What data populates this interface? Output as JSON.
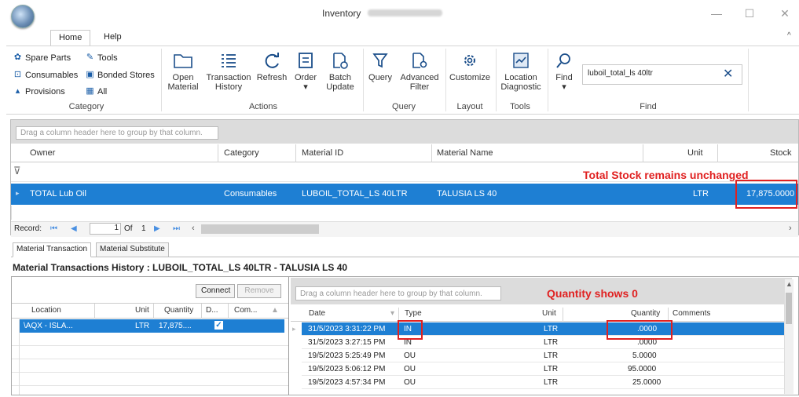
{
  "window": {
    "title": "Inventory",
    "min_label": "—",
    "max_label": "☐",
    "close_label": "✕"
  },
  "ribbon_tabs": {
    "home": "Home",
    "help": "Help",
    "collapse": "^"
  },
  "category": {
    "spare_parts": "Spare Parts",
    "tools": "Tools",
    "consumables": "Consumables",
    "bonded_stores": "Bonded Stores",
    "provisions": "Provisions",
    "all": "All",
    "label": "Category"
  },
  "actions": {
    "open_material": [
      "Open",
      "Material"
    ],
    "transaction_history": [
      "Transaction",
      "History"
    ],
    "refresh": "Refresh",
    "order": "Order",
    "batch_update": [
      "Batch",
      "Update"
    ],
    "label": "Actions"
  },
  "query": {
    "query": "Query",
    "advanced_filter": [
      "Advanced",
      "Filter"
    ],
    "label": "Query"
  },
  "layout": {
    "customize": "Customize",
    "label": "Layout"
  },
  "tools": {
    "location_diagnostic": [
      "Location",
      "Diagnostic"
    ],
    "label": "Tools"
  },
  "find": {
    "find": "Find",
    "value": "luboil_total_ls 40ltr",
    "label": "Find"
  },
  "upper_grid": {
    "group_hint": "Drag a column header here to group by that column.",
    "columns": {
      "owner": "Owner",
      "category": "Category",
      "material_id": "Material ID",
      "material_name": "Material Name",
      "unit": "Unit",
      "stock": "Stock"
    },
    "row": {
      "owner": "TOTAL Lub Oil",
      "category": "Consumables",
      "material_id": "LUBOIL_TOTAL_LS 40LTR",
      "material_name": "TALUSIA LS 40",
      "unit": "LTR",
      "stock": "17,875.0000"
    },
    "record_label": "Record:",
    "record_pos": "1",
    "record_of": "Of",
    "record_total": "1"
  },
  "annotations": {
    "stock": "Total Stock remains unchanged",
    "quantity": "Quantity shows 0"
  },
  "lower_tabs": {
    "transaction": "Material Transaction",
    "substitute": "Material Substitute"
  },
  "lower_title": "Material Transactions History : LUBOIL_TOTAL_LS 40LTR - TALUSIA LS 40",
  "location_grid": {
    "connect": "Connect",
    "remove": "Remove",
    "columns": {
      "location": "Location",
      "unit": "Unit",
      "quantity": "Quantity",
      "d": "D...",
      "com": "Com..."
    },
    "row": {
      "location": "\\AQX - ISLA...",
      "unit": "LTR",
      "quantity": "17,875...."
    }
  },
  "trans_grid": {
    "group_hint": "Drag a column header here to group by that column.",
    "columns": {
      "date": "Date",
      "type": "Type",
      "unit": "Unit",
      "quantity": "Quantity",
      "comments": "Comments"
    },
    "rows": [
      {
        "date": "31/5/2023 3:31:22 PM",
        "type": "IN",
        "unit": "LTR",
        "quantity": ".0000"
      },
      {
        "date": "31/5/2023 3:27:15 PM",
        "type": "IN",
        "unit": "LTR",
        "quantity": ".0000"
      },
      {
        "date": "19/5/2023 5:25:49 PM",
        "type": "OU",
        "unit": "LTR",
        "quantity": "5.0000"
      },
      {
        "date": "19/5/2023 5:06:12 PM",
        "type": "OU",
        "unit": "LTR",
        "quantity": "95.0000"
      },
      {
        "date": "19/5/2023 4:57:34 PM",
        "type": "OU",
        "unit": "LTR",
        "quantity": "25.0000"
      }
    ]
  }
}
